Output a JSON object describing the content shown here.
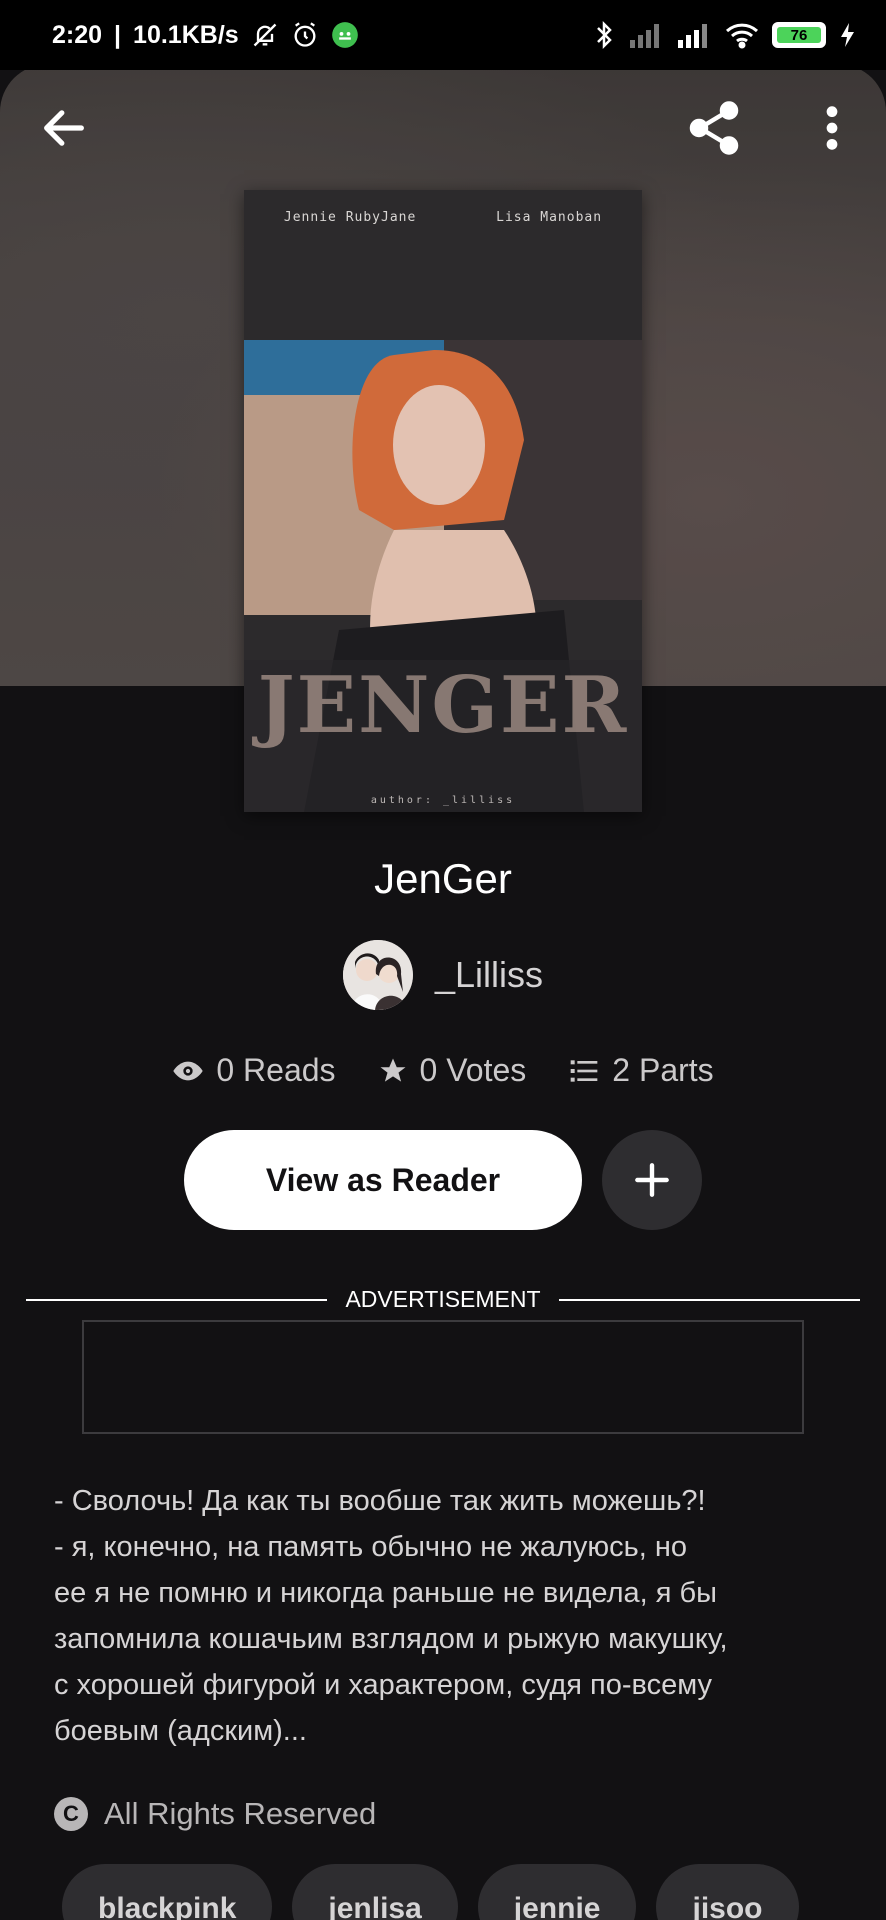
{
  "status_bar": {
    "time": "2:20",
    "speed": "10.1KB/s",
    "battery": "76",
    "icons": [
      "bell-muted-icon",
      "alarm-icon",
      "app-notification-icon",
      "bluetooth-icon",
      "signal-icon",
      "signal-icon",
      "wifi-icon",
      "battery-icon",
      "charging-icon"
    ]
  },
  "nav": {
    "back_icon": "arrow-left-icon",
    "share_icon": "share-icon",
    "more_icon": "more-vertical-icon"
  },
  "cover": {
    "top_left": "Jennie RubyJane",
    "top_right": "Lisa Manoban",
    "title": "JENGER",
    "author": "author: _lilliss"
  },
  "story": {
    "title": "JenGer",
    "author": "_Lilliss",
    "reads": "0 Reads",
    "votes": "0 Votes",
    "parts": "2 Parts"
  },
  "actions": {
    "reader_label": "View as Reader",
    "add_label": "+"
  },
  "ad": {
    "label": "ADVERTISEMENT"
  },
  "description": "- Сволочь! Да как ты вообше так жить можешь?!\n- я, конечно, на память обычно не жалуюсь, но\nее я не помню и никогда раньше не видела, я бы\nзапомнила кошачьим взглядом и рыжую макушку,\nс хорошей фигурой и характером, судя по-всему\nбоевым (адским)...",
  "rights": "All Rights Reserved",
  "tags": [
    "blackpink",
    "jenlisa",
    "jennie",
    "jisoo"
  ]
}
